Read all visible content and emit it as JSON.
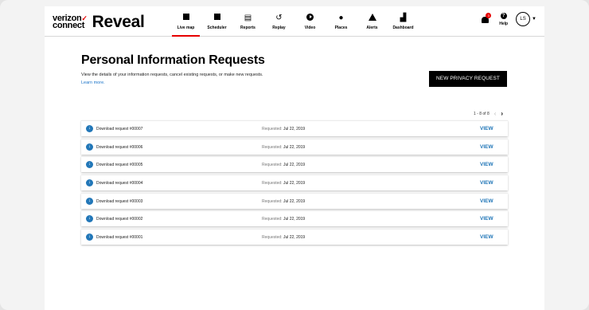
{
  "brand": {
    "top": "verizon",
    "bottom": "connect",
    "product": "Reveal",
    "accent": "#e60000"
  },
  "nav": [
    {
      "label": "Live map",
      "icon": "live-map-icon",
      "active": true
    },
    {
      "label": "Scheduler",
      "icon": "scheduler-icon"
    },
    {
      "label": "Reports",
      "icon": "reports-icon"
    },
    {
      "label": "Replay",
      "icon": "replay-icon"
    },
    {
      "label": "Video",
      "icon": "video-icon"
    },
    {
      "label": "Places",
      "icon": "places-icon"
    },
    {
      "label": "Alerts",
      "icon": "alerts-icon"
    },
    {
      "label": "Dashboard",
      "icon": "dashboard-icon"
    }
  ],
  "header": {
    "notifications_count": "3",
    "help_label": "Help",
    "avatar_initials": "LS"
  },
  "page": {
    "title": "Personal Information Requests",
    "description": "View the details of your information requests, cancel existing requests, or make new requests.",
    "learn_more": "Learn more.",
    "new_button": "NEW PRIVACY REQUEST",
    "pagination": "1 - 8 of 8"
  },
  "requests": [
    {
      "name": "Download request #00007",
      "label": "Requested:",
      "date": "Jul 22, 2019",
      "action": "VIEW"
    },
    {
      "name": "Download request #00006",
      "label": "Requested:",
      "date": "Jul 22, 2019",
      "action": "VIEW"
    },
    {
      "name": "Download request #00005",
      "label": "Requested:",
      "date": "Jul 22, 2019",
      "action": "VIEW"
    },
    {
      "name": "Download request #00004",
      "label": "Requested:",
      "date": "Jul 22, 2019",
      "action": "VIEW"
    },
    {
      "name": "Download request #00003",
      "label": "Requested:",
      "date": "Jul 22, 2019",
      "action": "VIEW"
    },
    {
      "name": "Download request #00002",
      "label": "Requested:",
      "date": "Jul 22, 2019",
      "action": "VIEW"
    },
    {
      "name": "Download request #00001",
      "label": "Requested:",
      "date": "Jul 22, 2019",
      "action": "VIEW"
    }
  ],
  "colors": {
    "link": "#2277b8",
    "primary_button": "#000000"
  }
}
